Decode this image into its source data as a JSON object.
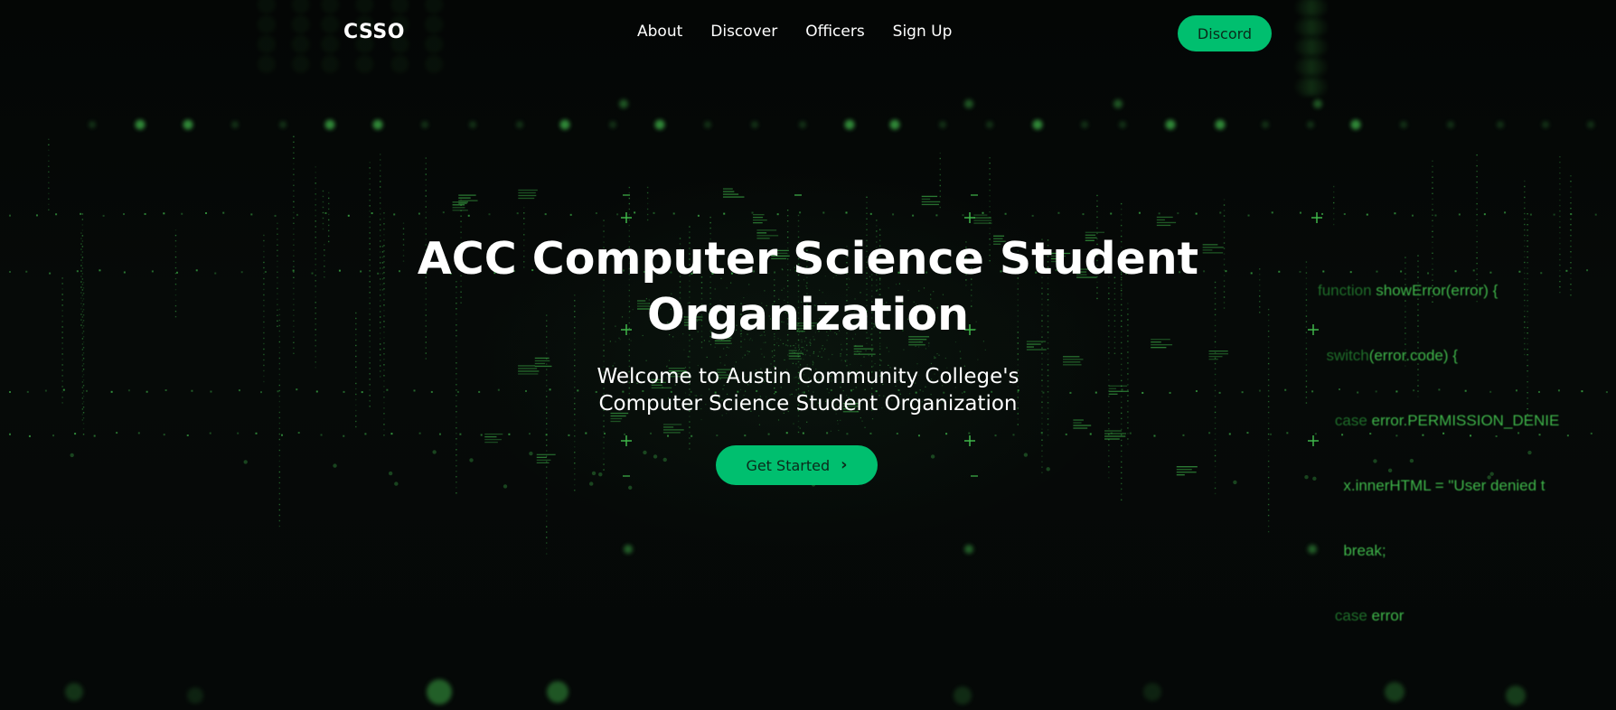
{
  "nav": {
    "logo": "CSSO",
    "links": [
      {
        "label": "About"
      },
      {
        "label": "Discover"
      },
      {
        "label": "Officers"
      },
      {
        "label": "Sign Up"
      }
    ],
    "discord_label": "Discord"
  },
  "hero": {
    "title": "ACC Computer Science Student Organization",
    "subtitle_line1": "Welcome to Austin Community College's",
    "subtitle_line2": "Computer Science Student Organization",
    "cta_label": "Get Started",
    "cta_icon": "chevron-right-icon"
  },
  "background_code": {
    "lines": [
      {
        "dim": "function ",
        "bright": "showError(error) {"
      },
      {
        "dim": "  switch",
        "bright": "(error.code) {"
      },
      {
        "dim": "    case ",
        "bright": "error.PERMISSION_DENIE"
      },
      {
        "dim": "      ",
        "bright": "x.innerHTML = \"User denied t"
      },
      {
        "dim": "      ",
        "bright": "break;"
      },
      {
        "dim": "    case ",
        "bright": "error"
      }
    ]
  },
  "colors": {
    "accent": "#00bf6f",
    "background": "#050807",
    "matrix_green": "#3fb54a"
  }
}
